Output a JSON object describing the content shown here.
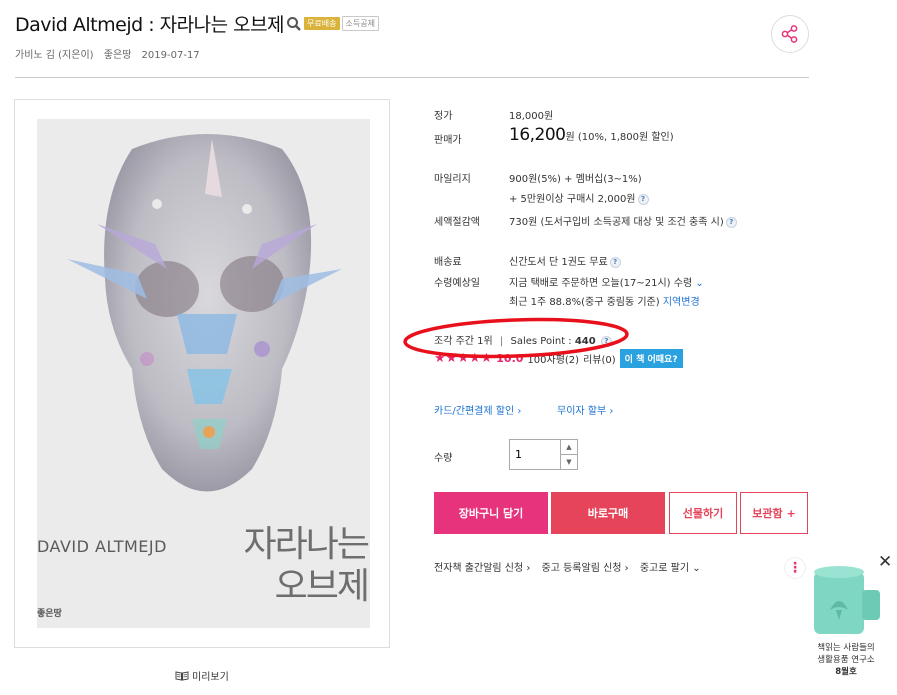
{
  "header": {
    "title": "David Altmejd : 자라나는 오브제",
    "badge_free_shipping": "무료배송",
    "badge_tax": "소득공제",
    "meta": {
      "author": "가비노 김 (지은이)",
      "publisher": "좋은땅",
      "date": "2019-07-17"
    }
  },
  "cover": {
    "title_en": "DAVID ALTMEJD",
    "title_kr_line1": "자라나는",
    "title_kr_line2": "오브제",
    "publisher": "좋은땅",
    "preview_label": "미리보기"
  },
  "price": {
    "list_label": "정가",
    "list_value": "18,000원",
    "sale_label": "판매가",
    "sale_price": "16,200",
    "sale_suffix": "원 (10%, 1,800원 할인)"
  },
  "mileage": {
    "label": "마일리지",
    "line1": "900원(5%) + 멤버십(3~1%)",
    "line2": "+ 5만원이상 구매시 2,000원"
  },
  "tax": {
    "label": "세액절감액",
    "value": "730원 (도서구입비 소득공제 대상 및 조건 충족 시)"
  },
  "shipping": {
    "fee_label": "배송료",
    "fee_value": "신간도서 단 1권도 무료",
    "eta_label": "수령예상일",
    "eta_value": "지금 택배로 주문하면 오늘(17~21시) 수령",
    "recent_value": "최근 1주 88.8%(중구 중림동 기준)",
    "region_change": "지역변경"
  },
  "rank": {
    "category_rank": "조각 주간 1위",
    "sales_point_label": "Sales Point :",
    "sales_point_value": "440"
  },
  "rating": {
    "score": "10.0",
    "score_value": 10.0,
    "stars_filled": 5,
    "comments": "100자평(2)",
    "reviews": "리뷰(0)",
    "ask_button": "이 책 어때요?"
  },
  "benefits": {
    "card_discount": "카드/간편결제 할인 ›",
    "installment": "무이자 할부 ›"
  },
  "quantity": {
    "label": "수량",
    "value": "1"
  },
  "buttons": {
    "cart": "장바구니 담기",
    "buy": "바로구매",
    "gift": "선물하기",
    "save": "보관함 +"
  },
  "bottom_links": {
    "ebook_alert": "전자책 출간알림 신청 ›",
    "used_alert": "중고 등록알림 신청 ›",
    "sell_used": "중고로 팔기 ⌄"
  },
  "side_ad": {
    "text_line1": "책읽는 사람들의",
    "text_line2": "생활용품 연구소",
    "text_line3": "8월호"
  },
  "colors": {
    "accent_pink": "#e6337b",
    "accent_red": "#e5445a",
    "link_blue": "#1b72d2",
    "annotation_red": "#e8101a"
  }
}
